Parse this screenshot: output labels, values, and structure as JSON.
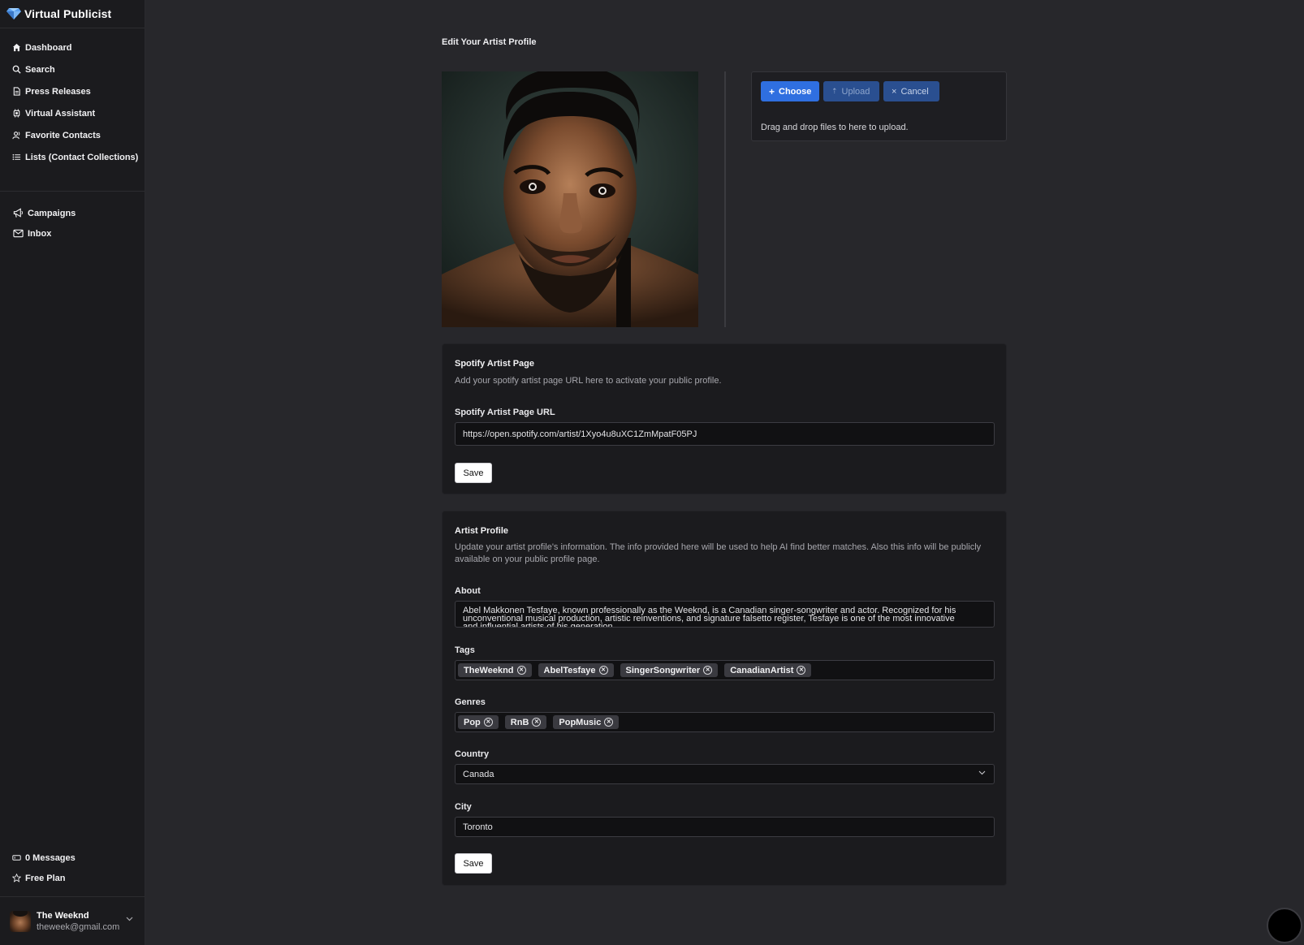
{
  "brand": {
    "name": "Virtual Publicist"
  },
  "sidebar": {
    "items": [
      {
        "label": "Dashboard",
        "icon": "home-icon"
      },
      {
        "label": "Search",
        "icon": "search-icon"
      },
      {
        "label": "Press Releases",
        "icon": "document-icon"
      },
      {
        "label": "Virtual Assistant",
        "icon": "chip-icon"
      },
      {
        "label": "Favorite Contacts",
        "icon": "contacts-icon"
      },
      {
        "label": "Lists (Contact Collections)",
        "icon": "list-icon"
      }
    ],
    "secondary": [
      {
        "label": "Campaigns",
        "icon": "megaphone-icon"
      },
      {
        "label": "Inbox",
        "icon": "mail-icon"
      }
    ],
    "bottom": [
      {
        "label": "0 Messages",
        "icon": "ticket-icon"
      },
      {
        "label": "Free Plan",
        "icon": "star-icon"
      }
    ],
    "user": {
      "name": "The Weeknd",
      "email": "theweek@gmail.com"
    }
  },
  "main": {
    "title": "Edit Your Artist Profile",
    "upload": {
      "choose_label": "Choose",
      "upload_label": "Upload",
      "cancel_label": "Cancel",
      "drop_text": "Drag and drop files to here to upload."
    },
    "spotify": {
      "title": "Spotify Artist Page",
      "description": "Add your spotify artist page URL here to activate your public profile.",
      "url_label": "Spotify Artist Page URL",
      "url_value": "https://open.spotify.com/artist/1Xyo4u8uXC1ZmMpatF05PJ",
      "save_label": "Save"
    },
    "profile": {
      "title": "Artist Profile",
      "description": "Update your artist profile's information. The info provided here will be used to help AI find better matches. Also this info will be publicly available on your public profile page.",
      "about_label": "About",
      "about_value": "Abel Makkonen Tesfaye, known professionally as the Weeknd, is a Canadian singer-songwriter and actor. Recognized for his unconventional musical production, artistic reinventions, and signature falsetto register, Tesfaye is one of the most innovative and influential artists of his generation.",
      "tags_label": "Tags",
      "tags": [
        "TheWeeknd",
        "AbelTesfaye",
        "SingerSongwriter",
        "CanadianArtist"
      ],
      "genres_label": "Genres",
      "genres": [
        "Pop",
        "RnB",
        "PopMusic"
      ],
      "country_label": "Country",
      "country_value": "Canada",
      "city_label": "City",
      "city_value": "Toronto",
      "save_label": "Save"
    }
  },
  "colors": {
    "background": "#27272b",
    "sidebar": "#1b1b1e",
    "card": "#1b1b1e",
    "accent": "#2f6fe0",
    "accent_muted": "#2a4f90"
  }
}
